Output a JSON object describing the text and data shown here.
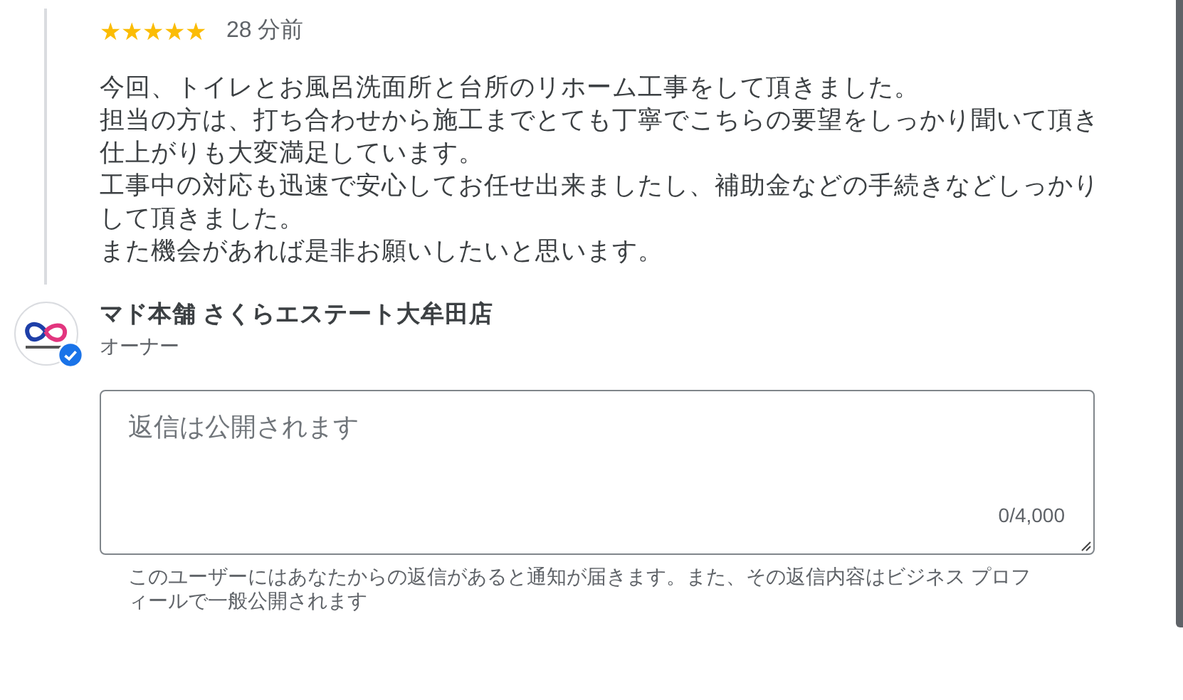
{
  "review": {
    "stars": 5,
    "time": "28 分前",
    "paragraphs": [
      "今回、トイレとお風呂洗面所と台所のリホーム工事をして頂きました。",
      "担当の方は、打ち合わせから施工までとても丁寧でこちらの要望をしっかり聞いて頂き仕上がりも大変満足しています。",
      "工事中の対応も迅速で安心してお任せ出来ましたし、補助金などの手続きなどしっかりして頂きました。",
      "また機会があれば是非お願いしたいと思います。"
    ]
  },
  "owner": {
    "name": "マド本舗 さくらエステート大牟田店",
    "role": "オーナー",
    "verified": true
  },
  "reply": {
    "placeholder": "返信は公開されます",
    "counter": "0/4,000",
    "notice": "このユーザーにはあなたからの返信があると通知が届きます。また、その返信内容はビジネス プロフィールで一般公開されます"
  }
}
